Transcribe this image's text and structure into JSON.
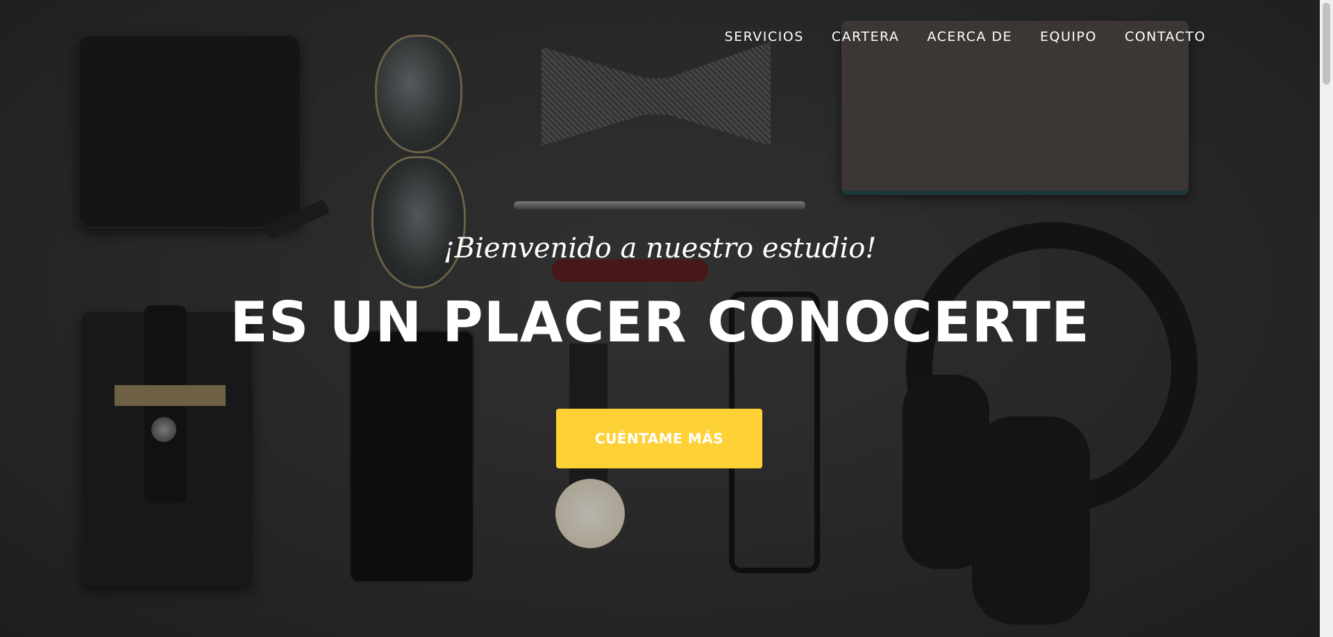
{
  "nav": {
    "items": [
      "SERVICIOS",
      "CARTERA",
      "ACERCA DE",
      "EQUIPO",
      "CONTACTO"
    ]
  },
  "hero": {
    "lead": "¡Bienvenido a nuestro estudio!",
    "heading": "ES UN PLACER CONOCERTE",
    "cta_label": "CUÉNTAME MÁS",
    "background": "dark flat-lay photo of accessories (wallet, sunglasses, bow tie, pen, notebook, phone sleeve, phone, watch, glasses, headphones)"
  },
  "colors": {
    "accent": "#fed136",
    "text": "#ffffff",
    "background": "#2e2e2e"
  }
}
